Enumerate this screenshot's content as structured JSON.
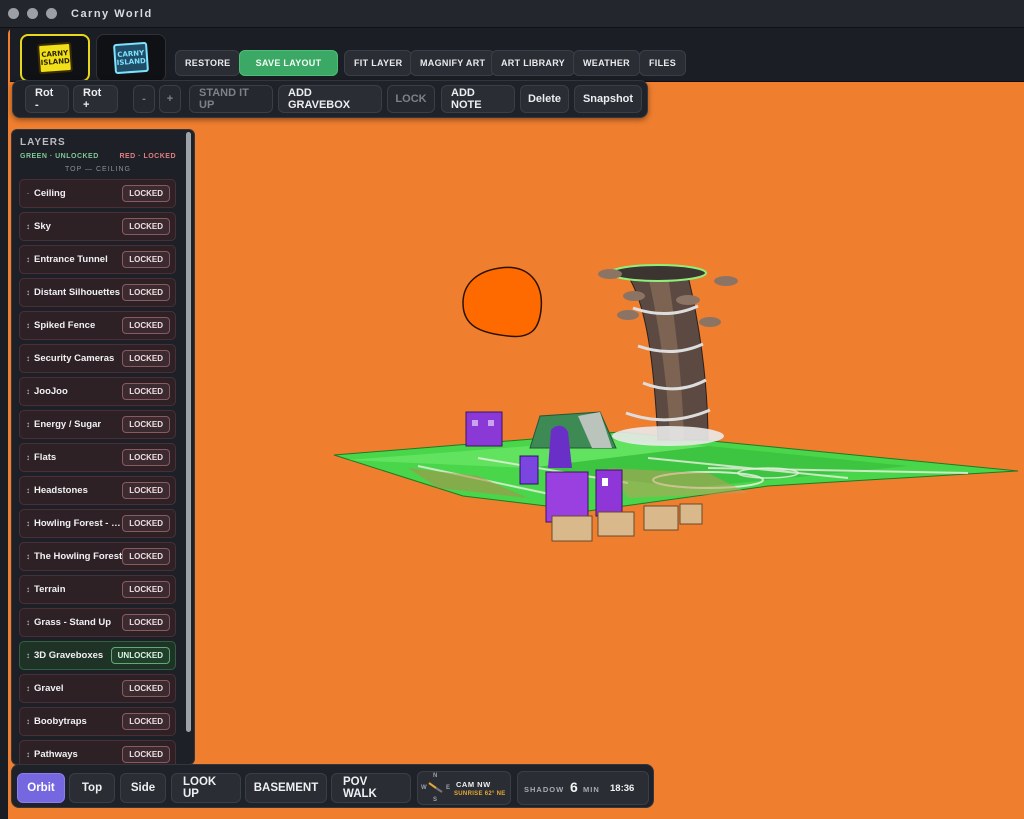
{
  "window": {
    "title": "Carny World"
  },
  "logos": [
    {
      "line1": "CARNY",
      "line2": "ISLAND"
    },
    {
      "line1": "CARNY",
      "line2": "ISLAND"
    }
  ],
  "toolbar": {
    "restore": "RESTORE",
    "save_layout": "SAVE LAYOUT",
    "fit_layer": "FIT LAYER",
    "magnify_art": "MAGNIFY ART",
    "art_library": "ART LIBRARY",
    "weather": "WEATHER",
    "files": "FILES"
  },
  "edit": {
    "rot_minus": "Rot -",
    "rot_plus": "Rot +",
    "minus": "-",
    "plus": "+",
    "stand_it_up": "STAND IT UP",
    "add_gravebox": "ADD GRAVEBOX",
    "lock": "LOCK",
    "add_note": "ADD NOTE",
    "delete": "Delete",
    "snapshot": "Snapshot"
  },
  "layers_panel": {
    "title": "LAYERS",
    "legend_green": "GREEN · UNLOCKED",
    "legend_red": "RED · LOCKED",
    "top_label": "TOP — CEILING",
    "items": [
      {
        "name": "Ceiling",
        "status": "LOCKED",
        "handle": "·"
      },
      {
        "name": "Sky",
        "status": "LOCKED",
        "handle": "↕"
      },
      {
        "name": "Entrance Tunnel",
        "status": "LOCKED",
        "handle": "↕"
      },
      {
        "name": "Distant Silhouettes",
        "status": "LOCKED",
        "handle": "↕"
      },
      {
        "name": "Spiked Fence",
        "status": "LOCKED",
        "handle": "↕"
      },
      {
        "name": "Security Cameras",
        "status": "LOCKED",
        "handle": "↕"
      },
      {
        "name": "JooJoo",
        "status": "LOCKED",
        "handle": "↕"
      },
      {
        "name": "Energy / Sugar",
        "status": "LOCKED",
        "handle": "↕"
      },
      {
        "name": "Flats",
        "status": "LOCKED",
        "handle": "↕"
      },
      {
        "name": "Headstones",
        "status": "LOCKED",
        "handle": "↕"
      },
      {
        "name": "Howling Forest - Trees",
        "status": "LOCKED",
        "handle": "↕"
      },
      {
        "name": "The Howling Forest",
        "status": "LOCKED",
        "handle": "↕"
      },
      {
        "name": "Terrain",
        "status": "LOCKED",
        "handle": "↕"
      },
      {
        "name": "Grass - Stand Up",
        "status": "LOCKED",
        "handle": "↕"
      },
      {
        "name": "3D Graveboxes",
        "status": "UNLOCKED",
        "handle": "↕"
      },
      {
        "name": "Gravel",
        "status": "LOCKED",
        "handle": "↕"
      },
      {
        "name": "Boobytraps",
        "status": "LOCKED",
        "handle": "↕"
      },
      {
        "name": "Pathways",
        "status": "LOCKED",
        "handle": "↕"
      }
    ]
  },
  "views": {
    "orbit": "Orbit",
    "top": "Top",
    "side": "Side",
    "look_up": "LOOK UP",
    "basement": "BASEMENT",
    "pov_walk": "POV WALK"
  },
  "compass": {
    "n": "N",
    "s": "S",
    "e": "E",
    "w": "W",
    "cam": "CAM NW",
    "sun": "SUNRISE 62° NE"
  },
  "shadow": {
    "label": "SHADOW",
    "value": "6",
    "unit": "MIN",
    "time": "18:36"
  },
  "colors": {
    "viewport_bg": "#ef7e2f",
    "active_view": "#7567e0",
    "save_green": "#3ca865",
    "locked_red": "#e07f82",
    "unlocked_green": "#7fc795"
  },
  "icons": {
    "compass": "compass-icon",
    "drag_handle": "drag-handle-icon"
  }
}
